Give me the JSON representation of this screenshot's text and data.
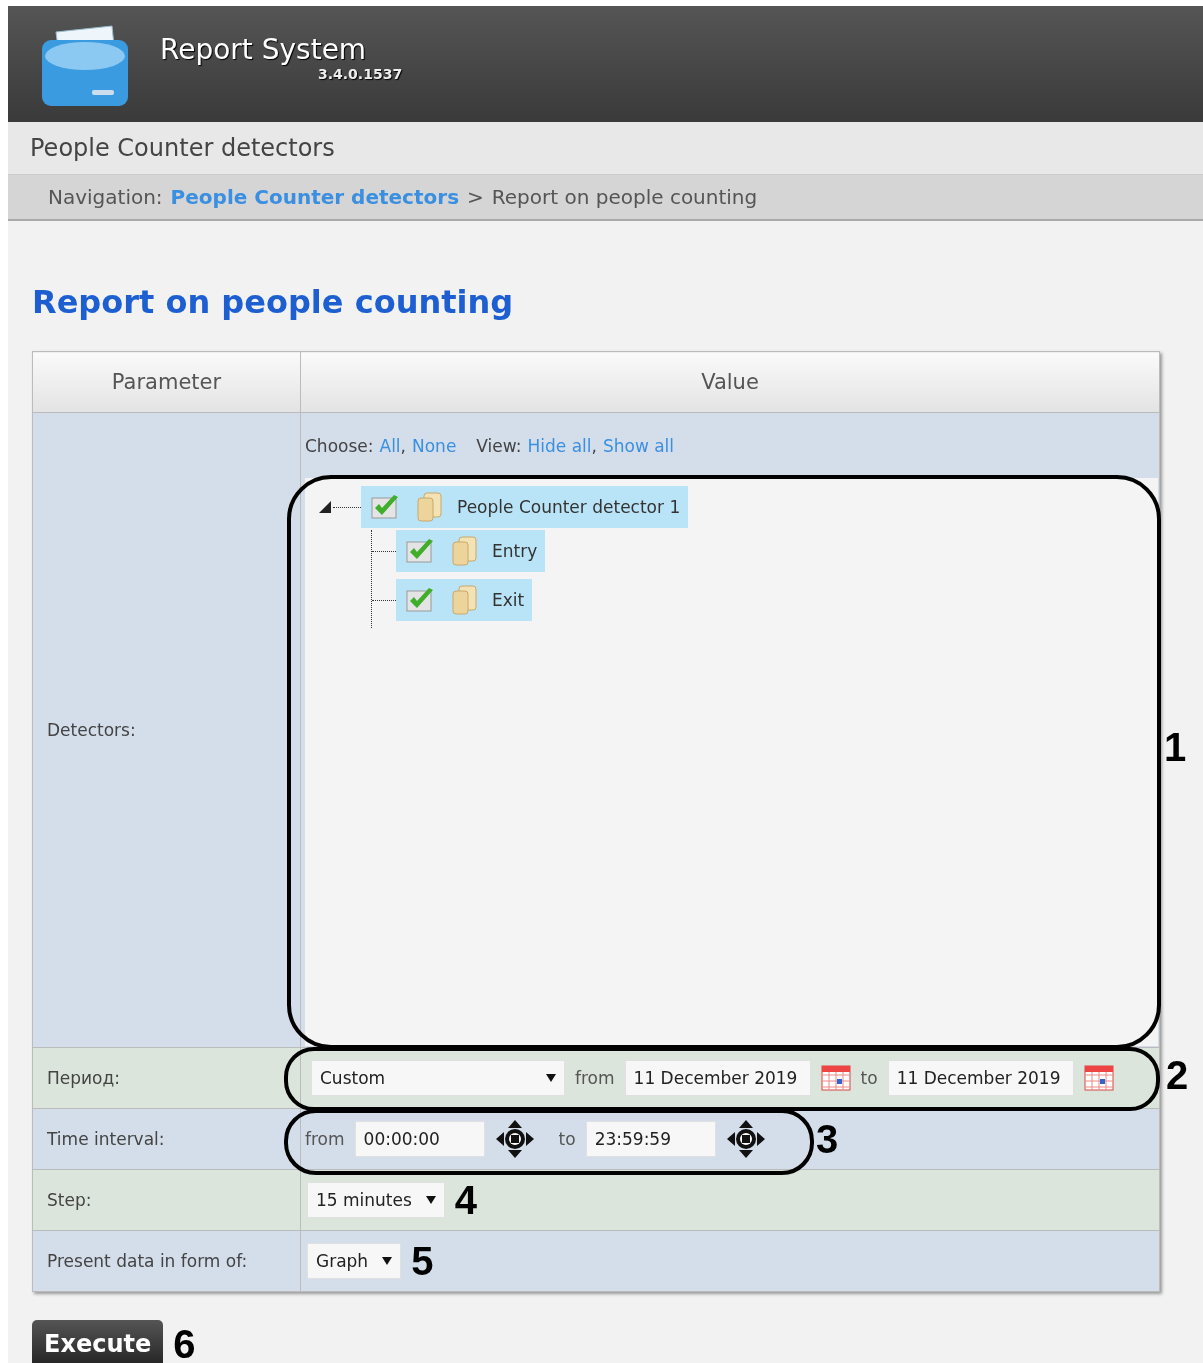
{
  "header": {
    "title": "Report System",
    "version": "3.4.0.1537"
  },
  "section_title": "People Counter detectors",
  "breadcrumb": {
    "label": "Navigation:",
    "link": "People Counter detectors",
    "separator": ">",
    "current": "Report on people counting"
  },
  "heading": "Report on people counting",
  "table": {
    "columns": [
      "Parameter",
      "Value"
    ],
    "detectors": {
      "label": "Detectors:",
      "choose_label": "Choose:",
      "link_separator": ",",
      "choose_links": [
        "All",
        "None"
      ],
      "view_label": "View:",
      "view_links": [
        "Hide all",
        "Show all"
      ],
      "tree": [
        {
          "label": "People Counter detector 1",
          "checked": true,
          "expanded": true,
          "children": [
            {
              "label": "Entry",
              "checked": true
            },
            {
              "label": "Exit",
              "checked": true
            }
          ]
        }
      ]
    },
    "period": {
      "label": "Период:",
      "value": "Custom",
      "from_label": "from",
      "from": "11 December 2019",
      "to_label": "to",
      "to": "11 December 2019"
    },
    "time_interval": {
      "label": "Time interval:",
      "from_label": "from",
      "from": "00:00:00",
      "to_label": "to",
      "to": "23:59:59"
    },
    "step": {
      "label": "Step:",
      "value": "15 minutes"
    },
    "present": {
      "label": "Present data in form of:",
      "value": "Graph"
    }
  },
  "execute_button": "Execute",
  "callouts": [
    "1",
    "2",
    "3",
    "4",
    "5",
    "6"
  ]
}
